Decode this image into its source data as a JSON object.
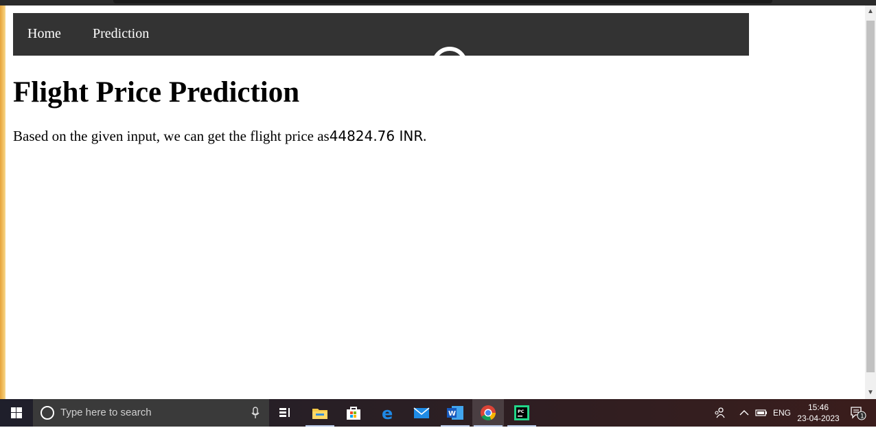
{
  "navbar": {
    "items": [
      {
        "label": "Home"
      },
      {
        "label": "Prediction"
      }
    ]
  },
  "main": {
    "title": "Flight Price Prediction",
    "result_prefix": "Based on the given input, we can get the flight price as",
    "result_value": "44824.76 INR."
  },
  "taskbar": {
    "search_placeholder": "Type here to search",
    "apps": [
      "task-view",
      "file-explorer",
      "microsoft-store",
      "edge",
      "mail",
      "word",
      "chrome",
      "pycharm"
    ],
    "active_app": "chrome",
    "language": "ENG",
    "time": "15:46",
    "date": "23-04-2023",
    "notification_count": "1"
  },
  "colors": {
    "navbar_bg": "#333333",
    "navbar_text": "#ffffff",
    "page_bg": "#ffffff"
  }
}
